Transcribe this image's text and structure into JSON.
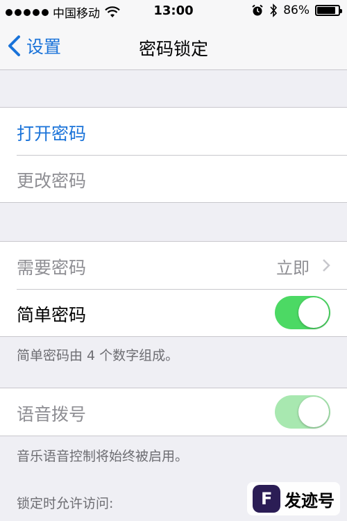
{
  "status_bar": {
    "carrier": "中国移动",
    "time": "13:00",
    "battery_percent": "86%",
    "battery_level": 0.86,
    "icons": [
      "signal-dots",
      "wifi-icon",
      "alarm-icon",
      "bluetooth-icon",
      "battery-icon"
    ]
  },
  "nav": {
    "back_label": "设置",
    "title": "密码锁定"
  },
  "colors": {
    "accent_blue": "#1a73d9",
    "toggle_green": "#4cd964",
    "toggle_green_disabled": "#a8e8b0",
    "background": "#efeff4"
  },
  "group1": {
    "turn_on_passcode": "打开密码",
    "change_passcode": "更改密码"
  },
  "group2": {
    "require_passcode": {
      "label": "需要密码",
      "value": "立即"
    },
    "simple_passcode": {
      "label": "简单密码",
      "on": true
    },
    "footer": "简单密码由 4 个数字组成。"
  },
  "group3": {
    "voice_dial": {
      "label": "语音拨号",
      "on": true,
      "enabled": false
    },
    "footer": "音乐语音控制将始终被启用。"
  },
  "section_header": "锁定时允许访问:",
  "watermark": {
    "text": "发迹号",
    "logo_letter": "F"
  }
}
